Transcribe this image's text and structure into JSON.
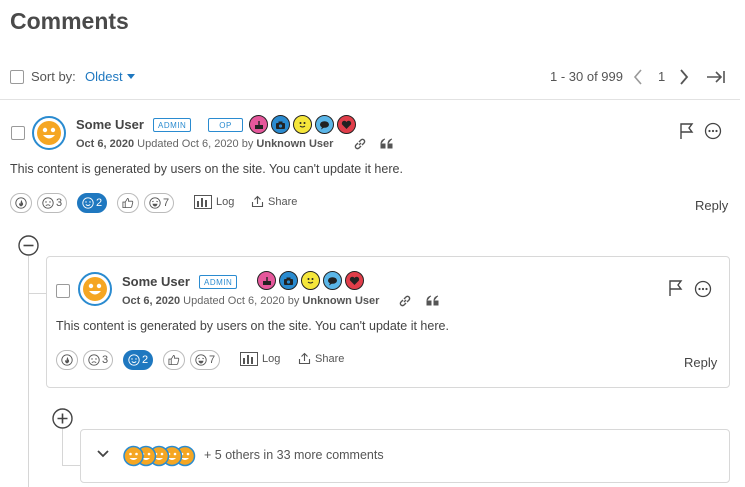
{
  "header": {
    "title": "Comments"
  },
  "toolbar": {
    "sort_label": "Sort by:",
    "sort_value": "Oldest",
    "range": "1 - 30 of 999",
    "page": "1"
  },
  "colors": {
    "accent": "#1f78c0",
    "avatar_border": "#2a8bd0",
    "face": "#f5a623"
  },
  "comments": [
    {
      "user": "Some User",
      "badges": [
        "ADMIN",
        "OP"
      ],
      "achievements": [
        "cake-icon",
        "camera-icon",
        "smiley-icon",
        "chat-icon",
        "heart-icon"
      ],
      "date": "Oct 6, 2020",
      "updated_prefix": "Updated Oct 6, 2020 by",
      "updated_by": "Unknown User",
      "body": "This content is generated by users on the site. You can't update it here.",
      "reactions": [
        {
          "icon": "fire-icon",
          "count": ""
        },
        {
          "icon": "sad-icon",
          "count": "3"
        },
        {
          "icon": "happy-icon",
          "count": "2"
        },
        {
          "icon": "thumbs-up-icon",
          "count": ""
        },
        {
          "icon": "laugh-icon",
          "count": "7"
        }
      ],
      "log_label": "Log",
      "share_label": "Share",
      "reply_label": "Reply"
    },
    {
      "user": "Some User",
      "badges": [
        "ADMIN"
      ],
      "achievements": [
        "cake-icon",
        "camera-icon",
        "smiley-icon",
        "chat-icon",
        "heart-icon"
      ],
      "date": "Oct 6, 2020",
      "updated_prefix": "Updated Oct 6, 2020 by",
      "updated_by": "Unknown User",
      "body": "This content is generated by users on the site. You can't update it here.",
      "reactions": [
        {
          "icon": "fire-icon",
          "count": ""
        },
        {
          "icon": "sad-icon",
          "count": "3"
        },
        {
          "icon": "happy-icon",
          "count": "2"
        },
        {
          "icon": "thumbs-up-icon",
          "count": ""
        },
        {
          "icon": "laugh-icon",
          "count": "7"
        }
      ],
      "log_label": "Log",
      "share_label": "Share",
      "reply_label": "Reply"
    }
  ],
  "more": {
    "text": "+ 5 others in 33 more comments"
  }
}
